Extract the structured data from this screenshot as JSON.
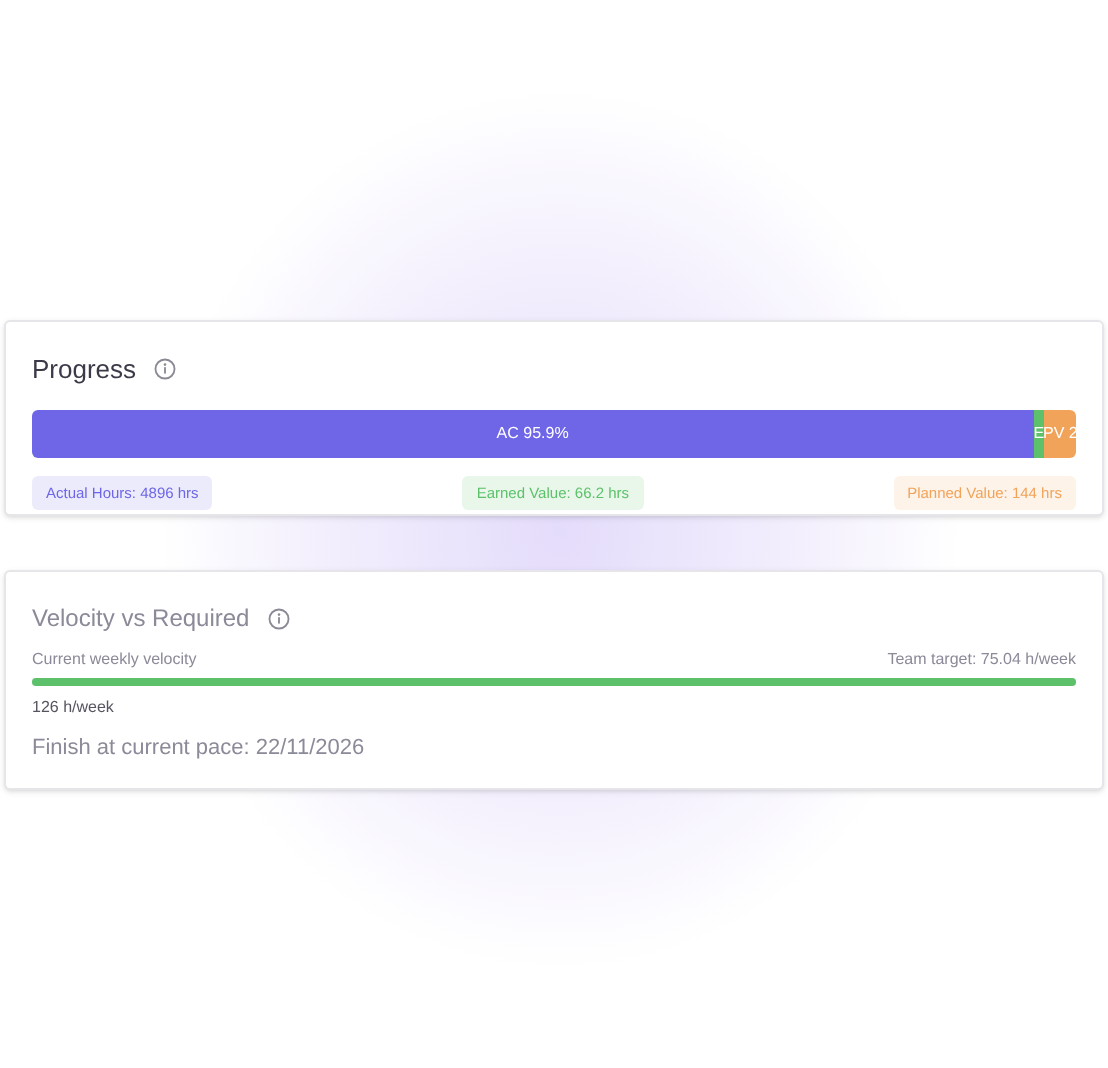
{
  "progress": {
    "title": "Progress",
    "segments": [
      {
        "label": "AC 95.9%",
        "color": "#6e66e6"
      },
      {
        "label": "E",
        "color": "#5cc16a"
      },
      {
        "label": "PV 2",
        "color": "#f2a35a"
      }
    ],
    "legend": [
      {
        "label": "Actual Hours: 4896 hrs",
        "color": "#6e66e6"
      },
      {
        "label": "Earned Value: 66.2 hrs",
        "color": "#5cc16a"
      },
      {
        "label": "Planned Value: 144 hrs",
        "color": "#f2a35a"
      }
    ]
  },
  "velocity": {
    "title": "Velocity vs Required",
    "left_caption": "Current weekly velocity",
    "right_caption": "Team target: 75.04 h/week",
    "level": 1,
    "reading": "126 h/week",
    "finish": "Finish at current pace: 22/11/2026"
  }
}
